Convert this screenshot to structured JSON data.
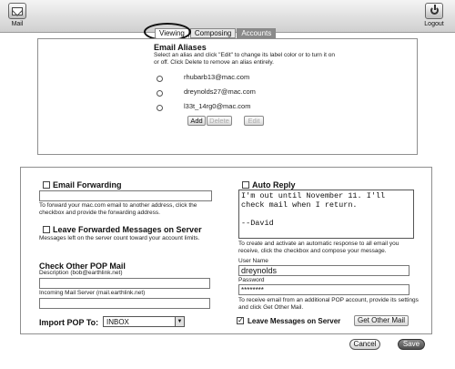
{
  "toolbar": {
    "mail_label": "Mail",
    "logout_label": "Logout"
  },
  "tabs": [
    {
      "label": "Viewing"
    },
    {
      "label": "Composing"
    },
    {
      "label": "Accounts"
    }
  ],
  "aliases": {
    "title": "Email Aliases",
    "help": "Select an alias and click \"Edit\" to change its label color or to turn it on or off. Click Delete to remove an alias entirely.",
    "items": [
      {
        "address": "rhubarb13@mac.com"
      },
      {
        "address": "dreynolds27@mac.com"
      },
      {
        "address": "l33t_14rg0@mac.com"
      }
    ],
    "add_label": "Add",
    "delete_label": "Delete",
    "edit_label": "Edit"
  },
  "forwarding": {
    "title": "Email Forwarding",
    "address": "",
    "help": "To forward your mac.com email to another address, click the checkbox and provide the forwarding address.",
    "leave_label": "Leave Forwarded Messages on Server",
    "leave_help": "Messages left on the server count toward your account limits."
  },
  "pop": {
    "title": "Check Other POP Mail",
    "description_label": "Description (bob@earthlink.net)",
    "description_value": "",
    "server_label": "Incoming Mail Server (mail.earthlink.net)",
    "server_value": "",
    "import_label": "Import POP To:",
    "import_value": "INBOX",
    "help": "To receive email from an additional POP account, provide its settings and click Get Other Mail.",
    "leave_label": "Leave Messages on Server",
    "leave_checked": true,
    "get_mail_label": "Get Other Mail",
    "username_label": "User Name",
    "username_value": "dreynolds",
    "password_label": "Password",
    "password_value": "********"
  },
  "auto_reply": {
    "title": "Auto Reply",
    "message": "I'm out until November 11. I'll check mail when I return.\n\n--David",
    "help": "To create and activate an automatic response to all email you receive, click the checkbox and compose your message."
  },
  "footer": {
    "cancel_label": "Cancel",
    "save_label": "Save"
  }
}
